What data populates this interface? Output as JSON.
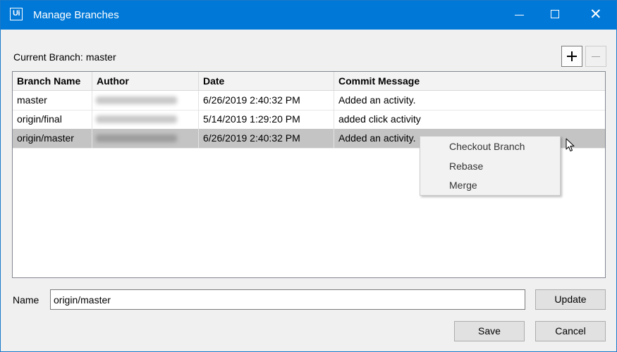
{
  "window": {
    "title": "Manage Branches",
    "app_icon_text": "Ui",
    "controls": {
      "minimize": "minimize-icon",
      "maximize": "maximize-icon",
      "close": "close-icon"
    }
  },
  "current_branch": {
    "label": "Current Branch:",
    "value": "master"
  },
  "toolbar": {
    "add_icon": "plus-icon",
    "remove_icon": "minus-icon"
  },
  "grid": {
    "columns": [
      "Branch Name",
      "Author",
      "Date",
      "Commit Message"
    ],
    "rows": [
      {
        "branch": "master",
        "date": "6/26/2019 2:40:32 PM",
        "message": "Added an activity."
      },
      {
        "branch": "origin/final",
        "date": "5/14/2019 1:29:20 PM",
        "message": "added click activity"
      },
      {
        "branch": "origin/master",
        "date": "6/26/2019 2:40:32 PM",
        "message": "Added an activity."
      }
    ],
    "selected_row": 2
  },
  "context_menu": {
    "items": [
      "Checkout Branch",
      "Rebase",
      "Merge"
    ]
  },
  "name_field": {
    "label": "Name",
    "value": "origin/master"
  },
  "buttons": {
    "update": "Update",
    "save": "Save",
    "cancel": "Cancel"
  },
  "colors": {
    "titlebar": "#0078d7",
    "selection": "#c4c4c4",
    "background": "#f0f0f0"
  }
}
